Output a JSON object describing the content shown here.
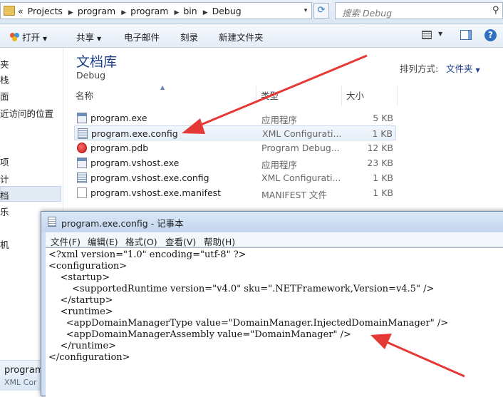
{
  "address_bar": {
    "chevron": "«",
    "crumbs": [
      "Projects",
      "program",
      "program",
      "bin",
      "Debug"
    ],
    "separator": "▶",
    "dropdown": "▾",
    "refresh_icon": "refresh-icon"
  },
  "search": {
    "placeholder": "搜索 Debug",
    "icon": "search-icon"
  },
  "toolbar": {
    "open_label": "打开",
    "share_label": "共享",
    "email_label": "电子邮件",
    "burn_label": "刻录",
    "new_folder_label": "新建文件夹",
    "dropdown": "▼",
    "help": "?"
  },
  "nav": {
    "items": [
      "夹",
      "栈",
      "面",
      "近访问的位置",
      "",
      "项",
      "计",
      "档",
      "乐",
      "",
      "",
      "",
      "机"
    ]
  },
  "library": {
    "title": "文档库",
    "subtitle": "Debug",
    "arrange_label": "排列方式:",
    "arrange_value": "文件夹",
    "arrange_dropdown": "▼"
  },
  "columns": {
    "name": "名称",
    "type": "类型",
    "size": "大小",
    "sort_arrow": "▲"
  },
  "files": [
    {
      "name": "program.exe",
      "type": "应用程序",
      "size": "5 KB",
      "icon": "exe",
      "selected": false
    },
    {
      "name": "program.exe.config",
      "type": "XML Configurati...",
      "size": "1 KB",
      "icon": "cfg",
      "selected": true
    },
    {
      "name": "program.pdb",
      "type": "Program Debug...",
      "size": "12 KB",
      "icon": "pdb",
      "selected": false
    },
    {
      "name": "program.vshost.exe",
      "type": "应用程序",
      "size": "23 KB",
      "icon": "exe",
      "selected": false
    },
    {
      "name": "program.vshost.exe.config",
      "type": "XML Configurati...",
      "size": "1 KB",
      "icon": "cfg",
      "selected": false
    },
    {
      "name": "program.vshost.exe.manifest",
      "type": "MANIFEST 文件",
      "size": "1 KB",
      "icon": "man",
      "selected": false
    }
  ],
  "details": {
    "name": "program",
    "type": "XML Cor"
  },
  "notepad": {
    "title": "program.exe.config - 记事本",
    "menus": [
      "文件(F)",
      "编辑(E)",
      "格式(O)",
      "查看(V)",
      "帮助(H)"
    ],
    "lines": [
      "<?xml version=\"1.0\" encoding=\"utf-8\" ?>",
      "<configuration>",
      "    <startup>",
      "        <supportedRuntime version=\"v4.0\" sku=\".NETFramework,Version=v4.5\" />",
      "    </startup>",
      "    <runtime>",
      "      <appDomainManagerType value=\"DomainManager.InjectedDomainManager\" />",
      "      <appDomainManagerAssembly value=\"DomainManager\" />",
      "    </runtime>",
      "</configuration>"
    ]
  },
  "colors": {
    "annotation_arrow": "#e53935",
    "library_title": "#1c3f8a"
  }
}
